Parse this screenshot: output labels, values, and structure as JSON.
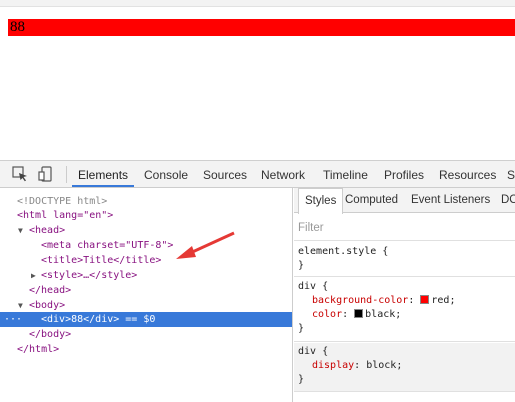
{
  "page": {
    "div_text": "88",
    "div_bg": "#ff0000"
  },
  "devtools": {
    "tabs": [
      "Elements",
      "Console",
      "Sources",
      "Network",
      "Timeline",
      "Profiles",
      "Resources",
      "S"
    ],
    "active_tab": "Elements",
    "icons": [
      "inspect-element-icon",
      "device-mode-icon"
    ],
    "dom": {
      "doctype": "<!DOCTYPE html>",
      "html_open": "<html lang=\"en\">",
      "head_open": "<head>",
      "meta": "<meta charset=\"UTF-8\">",
      "title": "<title>Title</title>",
      "style": "<style>…</style>",
      "head_close": "</head>",
      "body_open": "<body>",
      "div_line": "<div>88</div> == $0",
      "body_close": "</body>",
      "html_close": "</html>"
    },
    "styles": {
      "tabs": [
        "Styles",
        "Computed",
        "Event Listeners",
        "DC"
      ],
      "active_tab": "Styles",
      "filter_placeholder": "Filter",
      "rules": [
        {
          "selector": "element.style {",
          "props": [],
          "close": "}"
        },
        {
          "selector": "div {",
          "props": [
            {
              "name": "background-color",
              "value": "red",
              "swatch": "#ff0000"
            },
            {
              "name": "color",
              "value": "black",
              "swatch": "#000000"
            }
          ],
          "close": "}"
        },
        {
          "selector": "div {",
          "props": [
            {
              "name": "display",
              "value": "block"
            }
          ],
          "close": "}"
        }
      ]
    }
  },
  "colors": {
    "accent": "#3879d9",
    "annotation_arrow": "#e53935"
  }
}
